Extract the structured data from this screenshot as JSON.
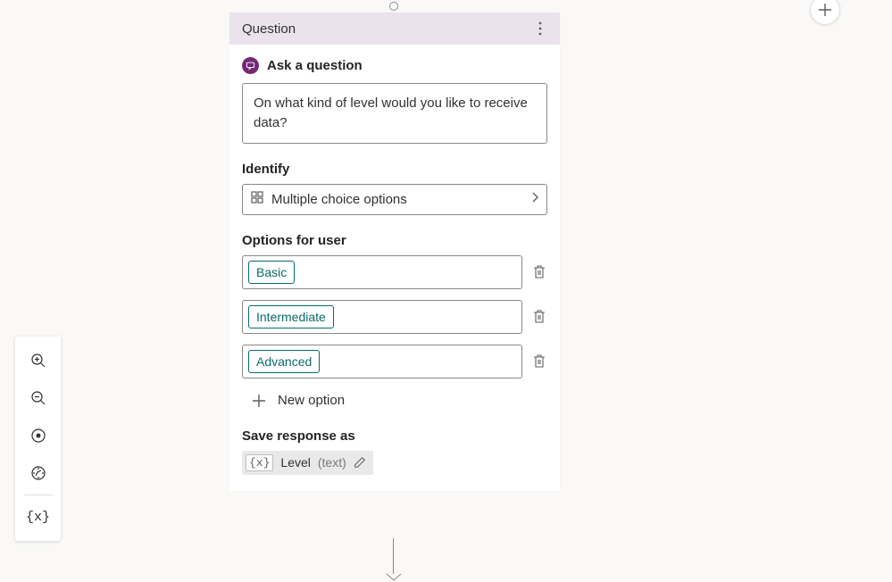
{
  "card": {
    "title": "Question",
    "section_title": "Ask a question",
    "question_text": "On what kind of level would you like to receive data?",
    "identify_label": "Identify",
    "identify_value": "Multiple choice options",
    "options_label": "Options for user",
    "options": [
      "Basic",
      "Intermediate",
      "Advanced"
    ],
    "new_option": "New option",
    "save_label": "Save response as",
    "variable": {
      "name": "Level",
      "type": "(text)"
    }
  }
}
